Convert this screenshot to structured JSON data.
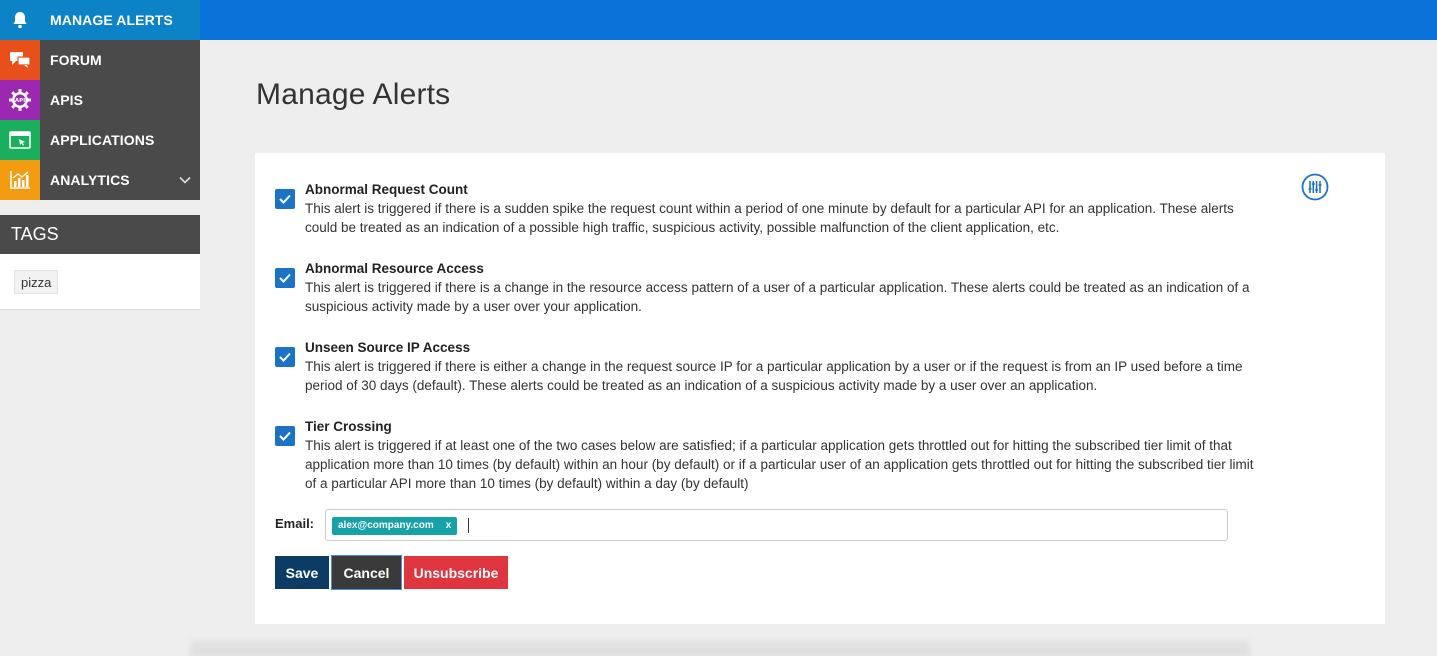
{
  "sidebar": {
    "items": [
      {
        "label": "MANAGE ALERTS",
        "icon": "bell-icon",
        "color": "#0b83c6"
      },
      {
        "label": "FORUM",
        "icon": "chat-icon",
        "color": "#e8501b"
      },
      {
        "label": "APIS",
        "icon": "api-gear-icon",
        "color": "#9c27b0"
      },
      {
        "label": "APPLICATIONS",
        "icon": "application-window-icon",
        "color": "#1aaf5d"
      },
      {
        "label": "ANALYTICS",
        "icon": "chart-icon",
        "color": "#f39c12"
      }
    ]
  },
  "tags": {
    "header": "TAGS",
    "items": [
      "pizza"
    ]
  },
  "page": {
    "title": "Manage Alerts"
  },
  "alerts": [
    {
      "title": "Abnormal Request Count",
      "description": "This alert is triggered if there is a sudden spike the request count within a period of one minute by default for a particular API for an application. These alerts could be treated as an indication of a possible high traffic, suspicious activity, possible malfunction of the client application, etc.",
      "checked": true
    },
    {
      "title": "Abnormal Resource Access",
      "description": "This alert is triggered if there is a change in the resource access pattern of a user of a particular application. These alerts could be treated as an indication of a suspicious activity made by a user over your application.",
      "checked": true
    },
    {
      "title": "Unseen Source IP Access",
      "description": "This alert is triggered if there is either a change in the request source IP for a particular application by a user or if the request is from an IP used before a time period of 30 days (default). These alerts could be treated as an indication of a suspicious activity made by a user over an application.",
      "checked": true
    },
    {
      "title": "Tier Crossing",
      "description": "This alert is triggered if at least one of the two cases below are satisfied; if a particular application gets throttled out for hitting the subscribed tier limit of that application more than 10 times (by default) within an hour (by default) or if a particular user of an application gets throttled out for hitting the subscribed tier limit of a particular API more than 10 times (by default) within a day (by default)",
      "checked": true
    }
  ],
  "email": {
    "label": "Email:",
    "tags": [
      "alex@company.com"
    ],
    "remove_glyph": "x",
    "value": ""
  },
  "buttons": {
    "save": "Save",
    "cancel": "Cancel",
    "unsubscribe": "Unsubscribe"
  },
  "colors": {
    "topbar": "#0b72d9",
    "sidebar": "#4a4a4a",
    "checkbox": "#1a73c7",
    "email_tag": "#17a2a8",
    "save": "#0c3c66",
    "cancel": "#3a3a3a",
    "unsubscribe": "#e0343f"
  }
}
